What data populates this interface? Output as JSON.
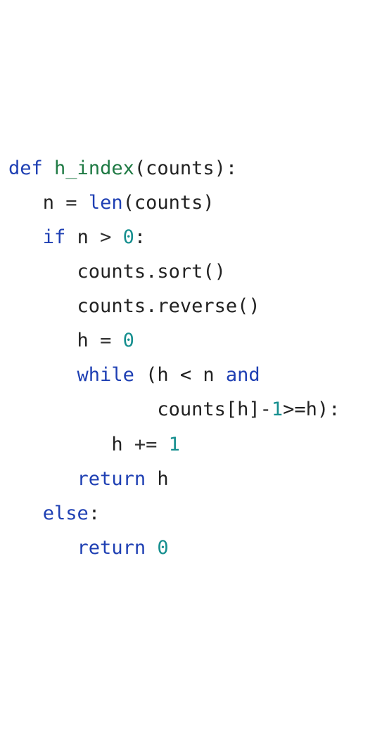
{
  "code": {
    "lang": "python",
    "function_name": "h_index",
    "param": "counts",
    "lines": {
      "l1": {
        "def": "def",
        "name": "h_index",
        "lp": "(",
        "arg": "counts",
        "rp": "):"
      },
      "l2": {
        "indent": "   ",
        "lhs": "n",
        "eq": " = ",
        "len": "len",
        "lp": "(",
        "arg": "counts",
        "rp": ")"
      },
      "l3": {
        "indent": "   ",
        "if": "if",
        "sp": " ",
        "var": "n",
        "op": " > ",
        "zero": "0",
        "colon": ":"
      },
      "l4": {
        "indent": "      ",
        "stmt": "counts.sort()"
      },
      "l5": {
        "indent": "      ",
        "stmt": "counts.reverse()"
      },
      "l6": {
        "indent": "      ",
        "lhs": "h",
        "eq": " = ",
        "zero": "0"
      },
      "l7": {
        "indent": "      ",
        "while": "while",
        "sp": " ",
        "lp": "(",
        "c1": "h < n",
        "sp2": " ",
        "and": "and"
      },
      "l8": {
        "indent": "             ",
        "expr_a": "counts[h]-",
        "one": "1",
        "expr_b": ">=h):"
      },
      "l9": {
        "indent": "         ",
        "lhs": "h",
        "op": " += ",
        "one": "1"
      },
      "l10": {
        "indent": "      ",
        "ret": "return",
        "sp": " ",
        "var": "h"
      },
      "l11": {
        "indent": "   ",
        "else": "else",
        "colon": ":"
      },
      "l12": {
        "indent": "      ",
        "ret": "return",
        "sp": " ",
        "zero": "0"
      }
    }
  }
}
